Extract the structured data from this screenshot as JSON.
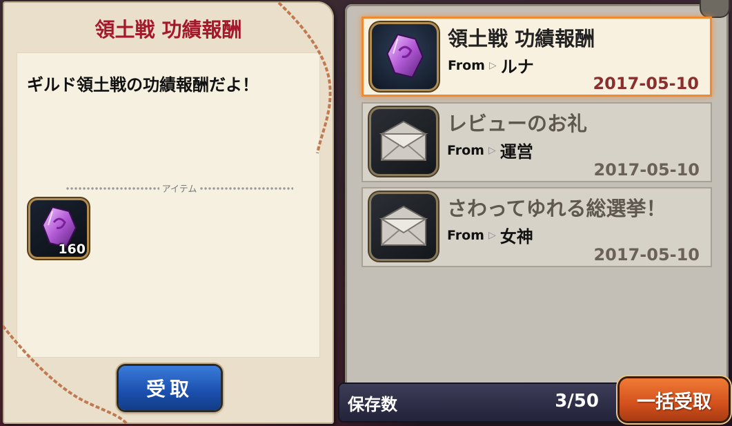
{
  "letter": {
    "title": "領土戦 功績報酬",
    "message": "ギルド領土戦の功績報酬だよ！",
    "items_label": "アイテム",
    "item": {
      "icon": "purple-crystal-icon",
      "count": "160"
    },
    "receive_label": "受取"
  },
  "mails": [
    {
      "title": "領土戦 功績報酬",
      "from_label": "From",
      "from": "ルナ",
      "date": "2017-05-10",
      "icon": "purple-crystal-icon",
      "selected": true
    },
    {
      "title": "レビューのお礼",
      "from_label": "From",
      "from": "運営",
      "date": "2017-05-10",
      "icon": "envelope-icon",
      "selected": false
    },
    {
      "title": "さわってゆれる総選挙！",
      "from_label": "From",
      "from": "女神",
      "date": "2017-05-10",
      "icon": "envelope-icon",
      "selected": false
    }
  ],
  "footer": {
    "storage_label": "保存数",
    "storage_count": "3/50",
    "bulk_receive_label": "一括受取"
  },
  "colors": {
    "title_red": "#a4182a",
    "selected_border": "#f08a32",
    "receive_button": "#1b4fae",
    "bulk_button": "#d2501c"
  }
}
